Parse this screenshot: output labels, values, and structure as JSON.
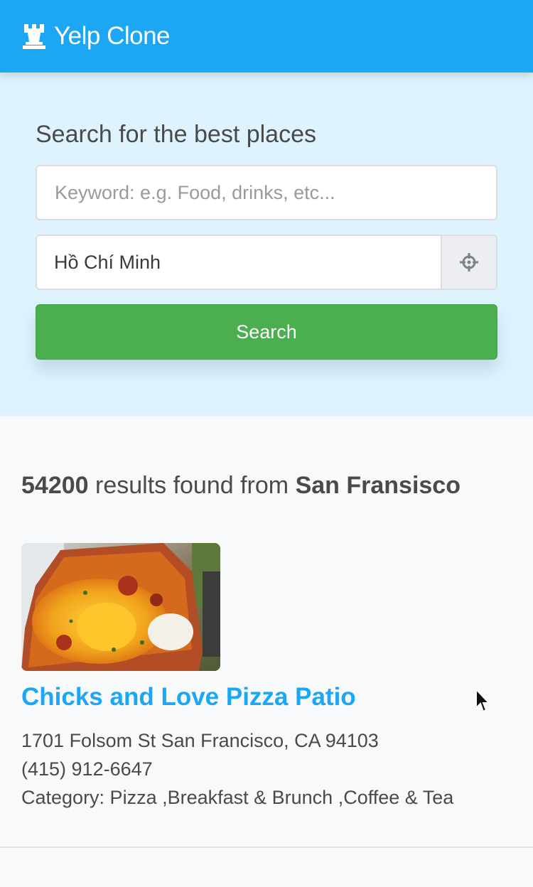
{
  "app": {
    "title": "Yelp Clone",
    "logo_icon": "rook-icon",
    "brand_color": "#1da6f3"
  },
  "search": {
    "heading": "Search for the best places",
    "keyword_placeholder": "Keyword: e.g. Food, drinks, etc...",
    "keyword_value": "",
    "location_value": "Hồ Chí Minh",
    "locate_icon": "crosshair-icon",
    "button_label": "Search",
    "button_color": "#4bae4f"
  },
  "results": {
    "count": "54200",
    "middle_text": " results found from ",
    "location": "San Fransisco",
    "items": [
      {
        "name": "Chicks and Love Pizza Patio",
        "address": "1701 Folsom St San Francisco, CA 94103",
        "phone": "(415) 912-6647",
        "category": "Category: Pizza ,Breakfast & Brunch ,Coffee & Tea"
      }
    ]
  }
}
